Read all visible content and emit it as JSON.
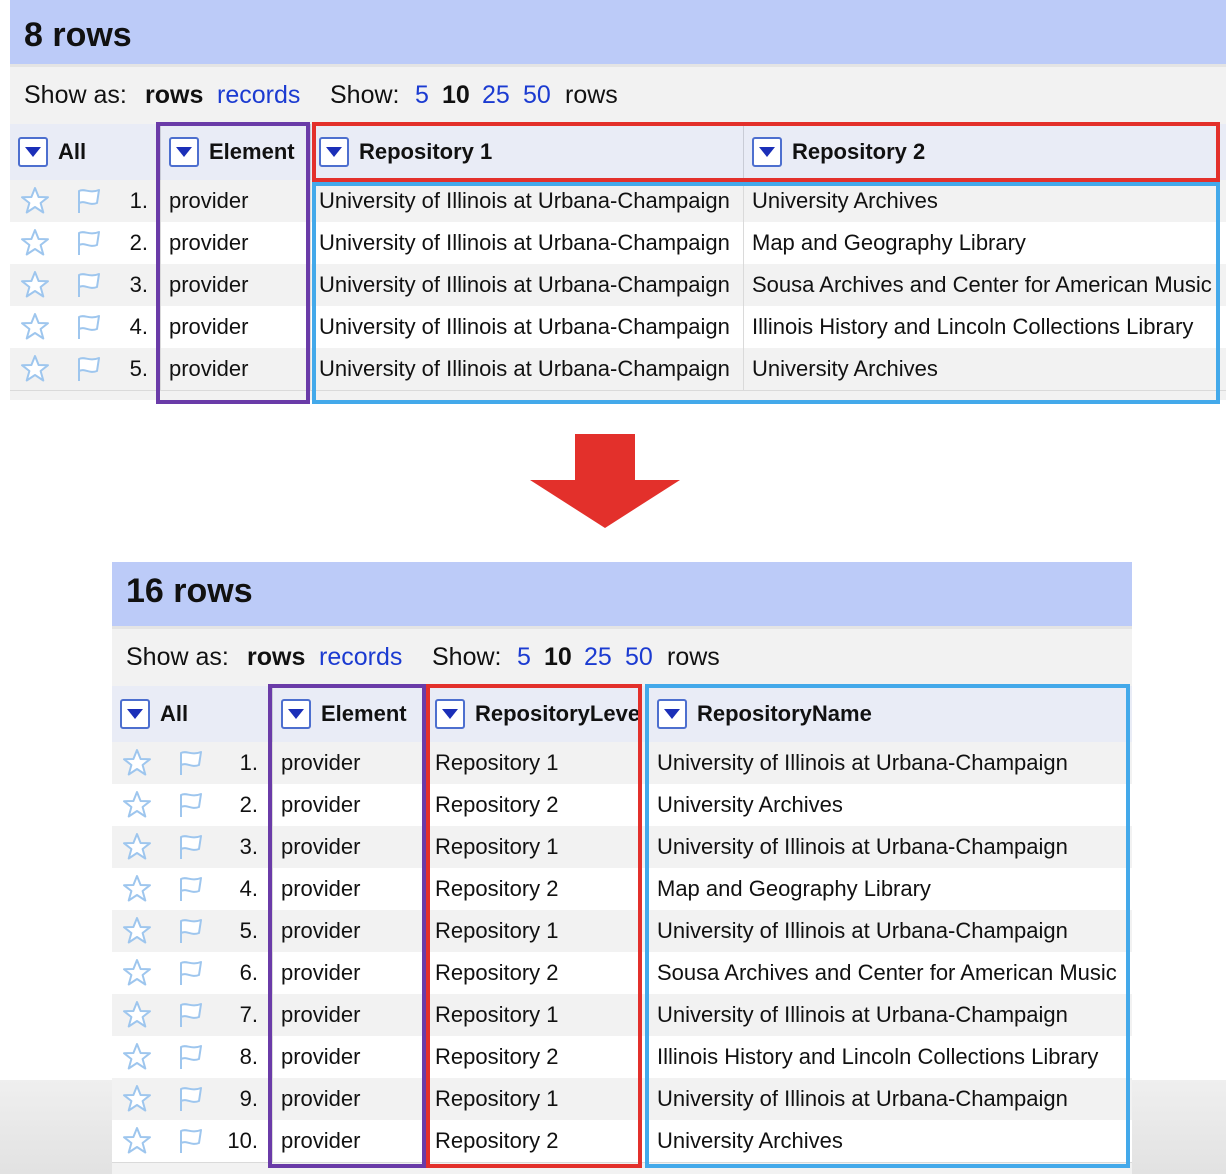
{
  "colors": {
    "count_bar": "#bccbf8",
    "link": "#1b3bd1",
    "highlight_purple": "#6a3ba8",
    "highlight_red": "#e3302b",
    "highlight_blue": "#43a9ea",
    "arrow": "#e3302b"
  },
  "icons": {
    "star": "star-icon",
    "flag": "flag-icon",
    "dropdown": "dropdown-arrow-icon",
    "transform_arrow": "down-arrow-icon"
  },
  "before": {
    "count": "8 rows",
    "viewbar": {
      "show_as_label": "Show as:",
      "rows_mode": "rows",
      "records_mode": "records",
      "show_label": "Show:",
      "page_sizes": [
        "5",
        "10",
        "25",
        "50"
      ],
      "selected_page_size": "10",
      "rows_suffix": "rows"
    },
    "columns": [
      "All",
      "Element",
      "Repository 1",
      "Repository 2"
    ],
    "rows": [
      {
        "num": "1.",
        "element": "provider",
        "repo1": "University of Illinois at Urbana-Champaign",
        "repo2": "University Archives"
      },
      {
        "num": "2.",
        "element": "provider",
        "repo1": "University of Illinois at Urbana-Champaign",
        "repo2": "Map and Geography Library"
      },
      {
        "num": "3.",
        "element": "provider",
        "repo1": "University of Illinois at Urbana-Champaign",
        "repo2": "Sousa Archives and Center for American Music"
      },
      {
        "num": "4.",
        "element": "provider",
        "repo1": "University of Illinois at Urbana-Champaign",
        "repo2": "Illinois History and Lincoln Collections Library"
      },
      {
        "num": "5.",
        "element": "provider",
        "repo1": "University of Illinois at Urbana-Champaign",
        "repo2": "University Archives"
      }
    ]
  },
  "after": {
    "count": "16 rows",
    "viewbar": {
      "show_as_label": "Show as:",
      "rows_mode": "rows",
      "records_mode": "records",
      "show_label": "Show:",
      "page_sizes": [
        "5",
        "10",
        "25",
        "50"
      ],
      "selected_page_size": "10",
      "rows_suffix": "rows"
    },
    "columns": [
      "All",
      "Element",
      "RepositoryLeve",
      "RepositoryName"
    ],
    "rows": [
      {
        "num": "1.",
        "element": "provider",
        "level": "Repository 1",
        "name": "University of Illinois at Urbana-Champaign"
      },
      {
        "num": "2.",
        "element": "provider",
        "level": "Repository 2",
        "name": "University Archives"
      },
      {
        "num": "3.",
        "element": "provider",
        "level": "Repository 1",
        "name": "University of Illinois at Urbana-Champaign"
      },
      {
        "num": "4.",
        "element": "provider",
        "level": "Repository 2",
        "name": "Map and Geography Library"
      },
      {
        "num": "5.",
        "element": "provider",
        "level": "Repository 1",
        "name": "University of Illinois at Urbana-Champaign"
      },
      {
        "num": "6.",
        "element": "provider",
        "level": "Repository 2",
        "name": "Sousa Archives and Center for American Music"
      },
      {
        "num": "7.",
        "element": "provider",
        "level": "Repository 1",
        "name": "University of Illinois at Urbana-Champaign"
      },
      {
        "num": "8.",
        "element": "provider",
        "level": "Repository 2",
        "name": "Illinois History and Lincoln Collections Library"
      },
      {
        "num": "9.",
        "element": "provider",
        "level": "Repository 1",
        "name": "University of Illinois at Urbana-Champaign"
      },
      {
        "num": "10.",
        "element": "provider",
        "level": "Repository 2",
        "name": "University Archives"
      }
    ]
  }
}
